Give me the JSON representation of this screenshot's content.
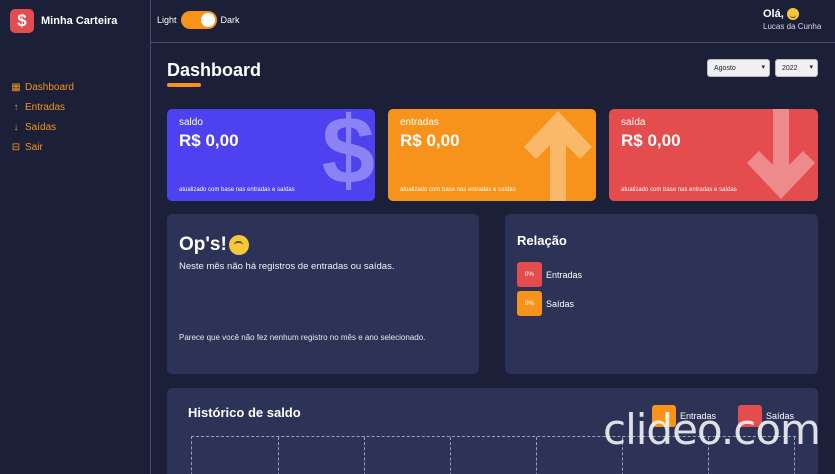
{
  "sidebar": {
    "brand_name": "Minha Carteira",
    "brand_icon": "$",
    "items": [
      {
        "label": "Dashboard",
        "icon": "dashboard-icon",
        "glyph": "▦"
      },
      {
        "label": "Entradas",
        "icon": "arrow-up-icon",
        "glyph": "↑"
      },
      {
        "label": "Saídas",
        "icon": "arrow-down-icon",
        "glyph": "↓"
      },
      {
        "label": "Sair",
        "icon": "exit-icon",
        "glyph": "⊟"
      }
    ]
  },
  "header": {
    "theme_light": "Light",
    "theme_dark": "Dark",
    "greeting": "Olá,",
    "username": "Lucas da Cunha"
  },
  "main": {
    "title": "Dashboard",
    "month": "Agosto",
    "year": "2022",
    "cards": [
      {
        "label": "saldo",
        "value": "R$ 0,00",
        "footer": "atualizado com base nas entradas e saídas",
        "color": "#4e41f0",
        "icon": "dollar-icon"
      },
      {
        "label": "entradas",
        "value": "R$ 0,00",
        "footer": "atualizado com base nas entradas e saídas",
        "color": "#f7931b",
        "icon": "arrow-up-icon"
      },
      {
        "label": "saída",
        "value": "R$ 0,00",
        "footer": "atualizado com base nas entradas e saídas",
        "color": "#e44c4e",
        "icon": "arrow-down-icon"
      }
    ],
    "message": {
      "title": "Op's!",
      "subtitle": "Neste mês não há registros de entradas ou saídas.",
      "note": "Parece que você não fez nenhum registro no mês e ano selecionado."
    },
    "relation": {
      "title": "Relação",
      "items": [
        {
          "percent": "0%",
          "label": "Entradas",
          "color": "#e44c4e"
        },
        {
          "percent": "0%",
          "label": "Saídas",
          "color": "#f7931b"
        }
      ]
    },
    "history": {
      "title": "Histórico de saldo",
      "legend": [
        {
          "label": "Entradas",
          "color": "#f7931b"
        },
        {
          "label": "Saídas",
          "color": "#e44c4e"
        }
      ]
    }
  },
  "watermark": "clideo.com"
}
